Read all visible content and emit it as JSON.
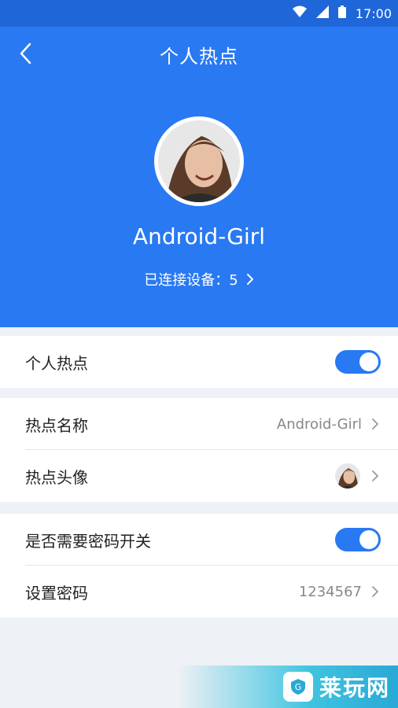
{
  "status_bar": {
    "time": "17:00",
    "icons": [
      "wifi-icon",
      "signal-icon",
      "battery-icon"
    ]
  },
  "header": {
    "title": "个人热点",
    "back_icon": "chevron-left-icon",
    "name": "Android-Girl",
    "connected_text": "已连接设备：5"
  },
  "sections": {
    "hotspot": {
      "label": "个人热点",
      "toggle_on": true
    },
    "name": {
      "label": "热点名称",
      "value": "Android-Girl"
    },
    "avatar": {
      "label": "热点头像"
    },
    "password_switch": {
      "label": "是否需要密码开关",
      "toggle_on": true
    },
    "password": {
      "label": "设置密码",
      "value": "1234567"
    }
  },
  "watermark": {
    "text": "莱玩网"
  },
  "colors": {
    "header_bg": "#2979f2",
    "statusbar_bg": "#1f66d9",
    "toggle_on": "#2979f2",
    "page_bg": "#eef1f5"
  }
}
